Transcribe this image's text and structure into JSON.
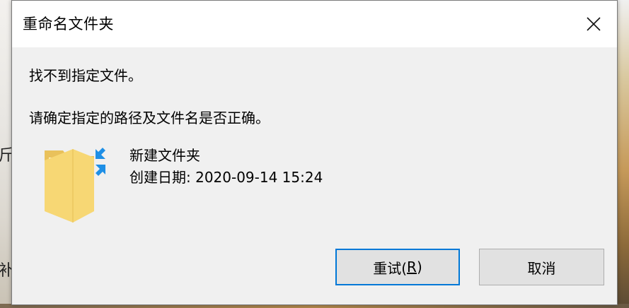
{
  "window": {
    "title": "重命名文件夹"
  },
  "messages": {
    "not_found": "找不到指定文件。",
    "check_path": "请确定指定的路径及文件名是否正确。"
  },
  "file": {
    "name": "新建文件夹",
    "created_label": "创建日期: 2020-09-14 15:24"
  },
  "buttons": {
    "retry_prefix": "重试(",
    "retry_accel": "R",
    "retry_suffix": ")",
    "cancel_label": "取消"
  },
  "desktop": {
    "left_fragments": [
      "fragment-1",
      "fragment-2"
    ],
    "left_fragment_texts": [
      "斤",
      "补"
    ]
  },
  "icons": {
    "close": "close-icon",
    "folder": "folder-icon",
    "arrows": "compress-arrows-icon"
  },
  "colors": {
    "accent": "#0078d7",
    "dialog_bg": "#f0f0f0",
    "titlebar_bg": "#ffffff",
    "button_bg": "#e1e1e1",
    "folder_yellow": "#f7d774",
    "arrow_blue": "#1e8fe6"
  }
}
